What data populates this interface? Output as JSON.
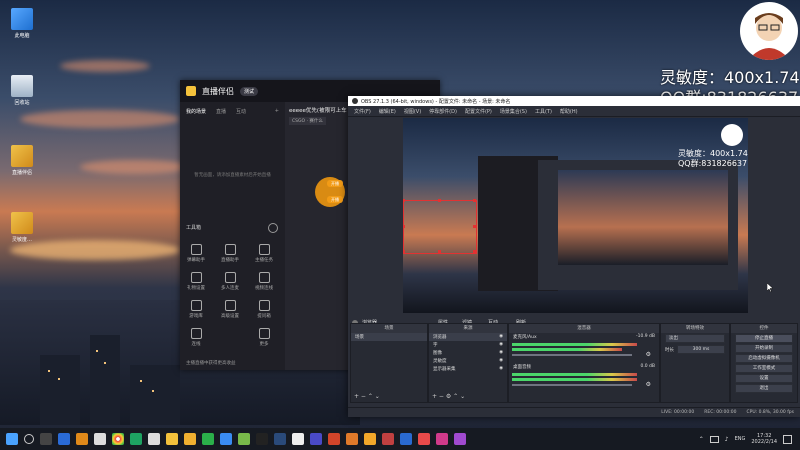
{
  "desktop": {
    "icons": [
      {
        "label": "此电脑"
      },
      {
        "label": "回收站"
      },
      {
        "label": "直播伴侣"
      },
      {
        "label": "灵敏度…"
      }
    ]
  },
  "overlay": {
    "sensitivity": "灵敏度：400x1.74",
    "qq": "QQ群:831826637"
  },
  "live_app": {
    "logo": "直播伴侣",
    "badge": "测试",
    "tabs": [
      "我的场景",
      "直播",
      "互动"
    ],
    "empty_hint": "暂无画面，请添加直播素材后开始直播",
    "stream_title": "eeeee优先(被限可上车",
    "game_tag": "CSGO · 赛什么",
    "orange_btn_1": "开播",
    "orange_btn_2": "开播",
    "tools_title": "工具箱",
    "tools": [
      "弹幕助手",
      "直播助手",
      "主播任务",
      "礼物设置",
      "多人连麦",
      "视频连线",
      "游戏库",
      "高级设置",
      "提问箱",
      "连线",
      "更多"
    ],
    "footer_note": "主播直播中获得更高收益"
  },
  "obs": {
    "title": "OBS 27.1.3 (64-bit, windows) - 配置文件: 未命名 - 场景: 未命名",
    "menu": [
      "文件(F)",
      "编辑(E)",
      "视图(V)",
      "停靠部件(D)",
      "配置文件(P)",
      "场景集合(S)",
      "工具(T)",
      "帮助(H)"
    ],
    "preview_overlay_1": "灵敏度：400x1.74",
    "preview_overlay_2": "QQ群:831826637",
    "toolbar": {
      "source_label": "浏览器",
      "properties": "属性",
      "filters": "滤镜",
      "interact": "互动",
      "refresh": "刷新"
    },
    "docks": {
      "scenes": {
        "title": "场景",
        "items": [
          "场景"
        ]
      },
      "sources": {
        "title": "来源",
        "items": [
          "浏览器",
          "字",
          "图像",
          "灵敏度",
          "显示器采集"
        ]
      },
      "mixer": {
        "title": "混音器",
        "channels": [
          {
            "name": "麦克风/Aux",
            "db": "-10.9 dB"
          },
          {
            "name": "桌面音频",
            "db": "0.0 dB"
          }
        ]
      },
      "transitions": {
        "title": "转场特效",
        "type": "淡出",
        "duration_label": "时长",
        "duration": "300 ms"
      },
      "controls": {
        "title": "控件",
        "buttons": [
          "停止直播",
          "开始录制",
          "启动虚拟摄像机",
          "工作室模式",
          "设置",
          "退出"
        ]
      }
    },
    "status": {
      "live": "LIVE: 00:00:00",
      "rec": "REC: 00:00:00",
      "cpu": "CPU: 0.8%, 30.00 fps"
    }
  },
  "taskbar": {
    "time": "17:32",
    "date": "2022/2/14",
    "lang": "ENG"
  }
}
